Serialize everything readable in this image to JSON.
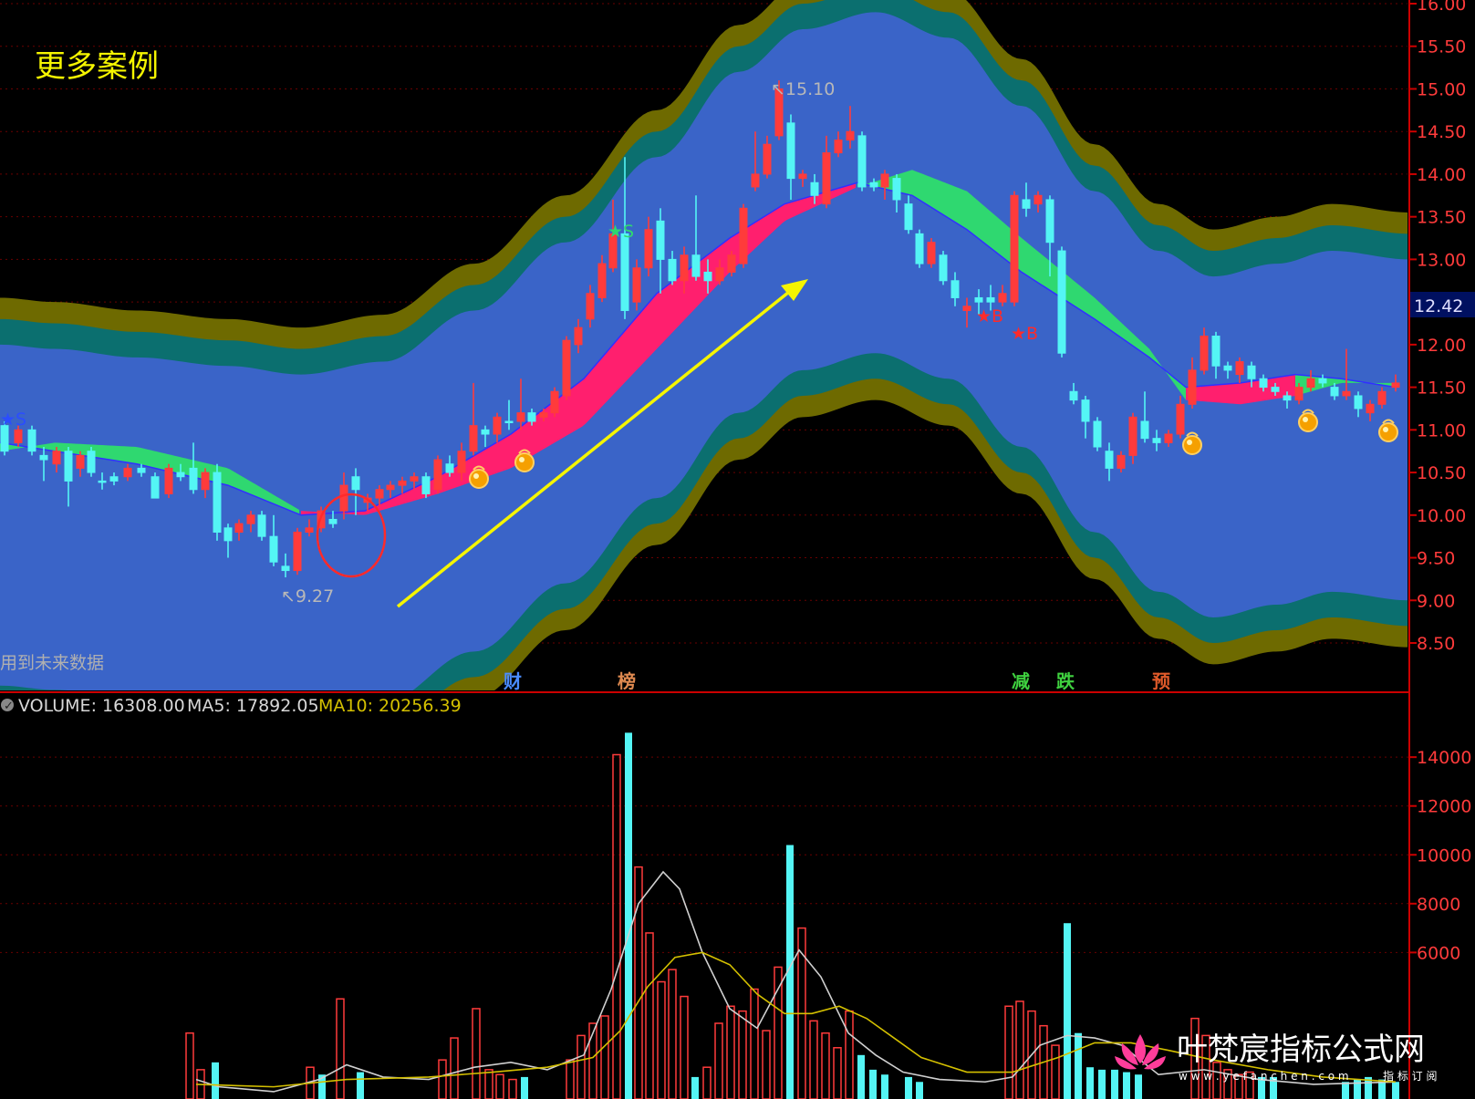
{
  "page_title": "更多案例",
  "notice_text": "用到未来数据",
  "price_label": "12.42",
  "high_label": "15.10",
  "low_label": "9.27",
  "signals": {
    "s1": "★S",
    "s2": "★S",
    "b1": "★B",
    "b2": "★B"
  },
  "events": [
    {
      "label": "财",
      "color": "#4a8cff"
    },
    {
      "label": "榜",
      "color": "#e08a50"
    },
    {
      "label": "减",
      "color": "#3fd13f"
    },
    {
      "label": "跌",
      "color": "#3fd13f"
    },
    {
      "label": "预",
      "color": "#e05a2a"
    }
  ],
  "volume_header": {
    "volume": "VOLUME: 16308.00",
    "ma5": "MA5: 17892.05",
    "ma10": "MA10: 20256.39"
  },
  "watermark": {
    "title": "叶梵宸指标公式网",
    "sub": "w w w . y e f a n c h e n . c o m",
    "sub2": "指 标 订 阅"
  },
  "colors": {
    "background": "#000000",
    "axis": "#cc0000",
    "up": "#ff3b3b",
    "down": "#54f5f5",
    "band_outer": "#6e6a00",
    "band_mid": "#0b6f6f",
    "band_inner": "#3a64c8",
    "ribbon_up": "#ff1f6e",
    "ribbon_down": "#2fd870",
    "arrow": "#f5f500",
    "title": "#f5f500",
    "ma5_line": "#d0d0d0",
    "ma10_line": "#d4c000"
  },
  "chart_data": [
    {
      "type": "candlestick",
      "title": "",
      "ylim": [
        8.3,
        16.0
      ],
      "yticks": [
        8.5,
        9.0,
        9.5,
        10.0,
        10.5,
        11.0,
        11.5,
        12.0,
        12.5,
        13.0,
        13.5,
        14.0,
        14.5,
        15.0,
        15.5,
        16.0
      ],
      "ytick_labels": [
        "8.50",
        "9.00",
        "9.50",
        "10.00",
        "10.50",
        "11.00",
        "11.50",
        "12.00",
        "12.50",
        "13.00",
        "13.50",
        "14.00",
        "14.50",
        "15.00",
        "15.50",
        "16.00"
      ],
      "current_price": 12.42,
      "high": 15.1,
      "low": 9.27,
      "grid": true
    },
    {
      "type": "bar",
      "title": "",
      "ylim": [
        0,
        15500
      ],
      "yticks": [
        6000,
        8000,
        10000,
        12000,
        14000
      ],
      "ytick_labels": [
        "6000",
        "8000",
        "10000",
        "12000",
        "14000"
      ],
      "series": [
        {
          "name": "VOLUME",
          "last": 16308.0
        },
        {
          "name": "MA5",
          "last": 17892.05
        },
        {
          "name": "MA10",
          "last": 20256.39
        }
      ]
    }
  ]
}
